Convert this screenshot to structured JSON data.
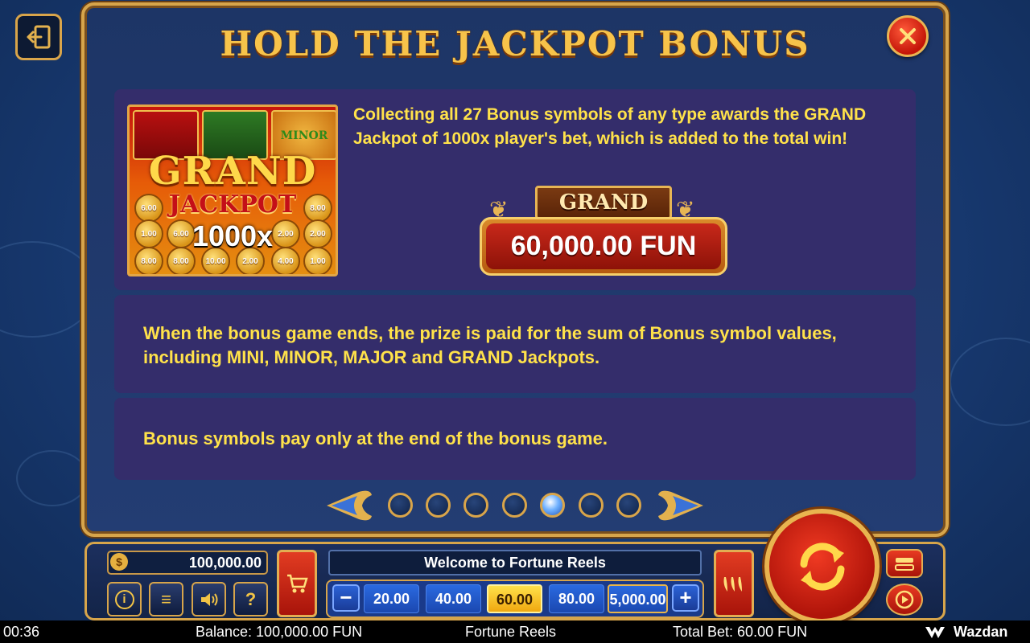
{
  "title": "HOLD THE JACKPOT BONUS",
  "jackpot_image": {
    "grand_text": "GRAND",
    "jackpot_text": "JACKPOT",
    "multiplier_text": "1000x",
    "minor_text": "MINOR",
    "coins": [
      "6.00",
      "8.00",
      "1.00",
      "6.00",
      "2.00",
      "2.00",
      "8.00",
      "8.00",
      "10.00",
      "2.00",
      "4.00",
      "1.00"
    ]
  },
  "card1_text": "Collecting all 27 Bonus symbols of any type awards the GRAND Jackpot of 1000x player's bet, which is added to the total win!",
  "grand_label": "GRAND",
  "grand_value": "60,000.00 FUN",
  "card2_text": "When the bonus game ends, the prize is paid for the sum of Bonus symbol values, including MINI, MINOR, MAJOR and GRAND Jackpots.",
  "card3_text": "Bonus symbols pay only at the end of the bonus game.",
  "pager": {
    "count": 7,
    "active_index": 4
  },
  "controls": {
    "balance_box": "100,000.00",
    "bag_symbol": "$",
    "info_symbol": "i",
    "menu_symbol": "≡",
    "help_symbol": "?",
    "welcome": "Welcome to Fortune Reels",
    "bets": [
      "20.00",
      "40.00",
      "60.00",
      "80.00",
      "5,000.00"
    ],
    "selected_bet_index": 2,
    "minus": "−",
    "plus": "+"
  },
  "footer": {
    "time": "00:36",
    "balance": "Balance: 100,000.00 FUN",
    "game": "Fortune Reels",
    "total_bet": "Total Bet: 60.00 FUN",
    "brand": "Wazdan"
  },
  "colors": {
    "accent_gold": "#d7a54b",
    "text_yellow": "#ffe24a",
    "card_bg": "#342d6b",
    "spin_red": "#c41508"
  }
}
